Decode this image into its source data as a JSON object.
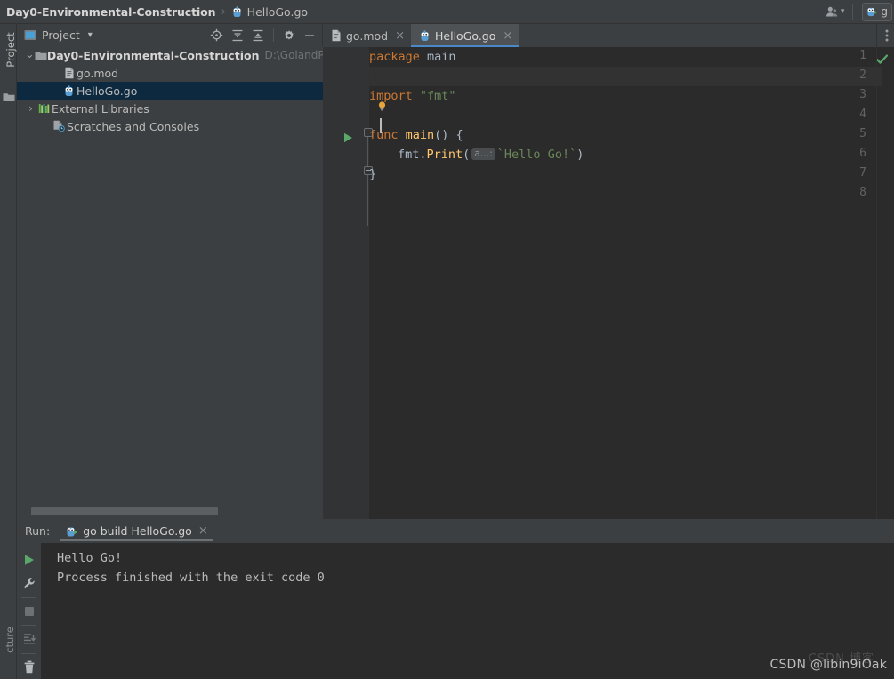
{
  "titlebar": {
    "project_name": "Day0-Environmental-Construction",
    "separator": "›",
    "file_name": "HelloGo.go",
    "user_icon": "user-account-icon",
    "user_caret": "▾",
    "run_config_label": "g"
  },
  "left_strip": {
    "project_label": "Project",
    "structure_label": "cture",
    "folder_icon": "folder-icon"
  },
  "project_panel": {
    "title": "Project",
    "dropdown_caret": "▾",
    "tools": [
      {
        "name": "locate-file-icon",
        "title": "Select Opened File"
      },
      {
        "name": "expand-all-icon",
        "title": "Expand All"
      },
      {
        "name": "collapse-all-icon",
        "title": "Collapse All"
      },
      {
        "name": "settings-gear-icon",
        "title": "Settings"
      },
      {
        "name": "hide-panel-icon",
        "title": "Hide"
      }
    ],
    "tree": [
      {
        "label": "Day0-Environmental-Construction",
        "path": "D:\\GolandProje",
        "icon": "folder-icon",
        "arrow": "⌄",
        "expanded": true,
        "bold": true,
        "indent": 0,
        "selected": false
      },
      {
        "label": "go.mod",
        "path": "",
        "icon": "go-mod-file-icon",
        "arrow": "",
        "expanded": false,
        "bold": false,
        "indent": 2,
        "selected": false
      },
      {
        "label": "HelloGo.go",
        "path": "",
        "icon": "go-file-icon",
        "arrow": "",
        "expanded": false,
        "bold": false,
        "indent": 2,
        "selected": true
      },
      {
        "label": "External Libraries",
        "path": "",
        "icon": "library-bars-icon",
        "arrow": "›",
        "expanded": false,
        "bold": false,
        "indent": 0,
        "selected": false
      },
      {
        "label": "Scratches and Consoles",
        "path": "",
        "icon": "scratches-clock-icon",
        "arrow": "",
        "expanded": false,
        "bold": false,
        "indent": 1,
        "selected": false
      }
    ]
  },
  "editor": {
    "tabs": [
      {
        "label": "go.mod",
        "icon": "go-mod-file-icon",
        "active": false,
        "close": "×"
      },
      {
        "label": "HelloGo.go",
        "icon": "go-file-icon",
        "active": true,
        "close": "×"
      }
    ],
    "more_options_icon": "vertical-dots-icon",
    "inspection_status": "no-problems-checkmark",
    "line_numbers": [
      "1",
      "2",
      "3",
      "4",
      "5",
      "6",
      "7",
      "8"
    ],
    "current_line": 2,
    "code": {
      "l1_kw": "package",
      "l1_name": "main",
      "l3_kw": "import",
      "l3_str": "\"fmt\"",
      "l5_kw": "func",
      "l5_fn": "main",
      "l5_tail": "() {",
      "l6_recv": "fmt",
      "l6_dot": ".",
      "l6_call": "Print",
      "l6_open": "(",
      "l6_hint": "a…:",
      "l6_str": "`Hello Go!`",
      "l6_close": ")",
      "l7_brace": "}"
    },
    "run_line_marker": "run-function-arrow"
  },
  "run_panel": {
    "label": "Run:",
    "tab_label": "go build HelloGo.go",
    "tab_icon": "go-run-icon",
    "tab_close": "×",
    "toolbar": [
      {
        "name": "rerun-icon",
        "title": "Rerun"
      },
      {
        "name": "wrench-settings-icon",
        "title": "Edit Configuration"
      },
      {
        "name": "stop-icon",
        "title": "Stop"
      },
      {
        "name": "scroll-to-end-icon",
        "title": "Scroll to End"
      },
      {
        "name": "trash-icon",
        "title": "Clear All"
      }
    ],
    "console_lines": [
      "Hello Go!",
      "Process finished with the exit code 0"
    ]
  },
  "watermark": {
    "text": "CSDN @libin9iOak",
    "ghost": "CSDN 博客"
  },
  "colors": {
    "panel_bg": "#3c3f41",
    "editor_bg": "#2b2b2b",
    "gutter_bg": "#313335",
    "selection_bg": "#0d293f",
    "accent_blue": "#4a88c7",
    "keyword_orange": "#cc7832",
    "string_green": "#6a8759",
    "function_yellow": "#ffc66d",
    "text_default": "#a9b7c6",
    "run_green": "#59a869"
  }
}
